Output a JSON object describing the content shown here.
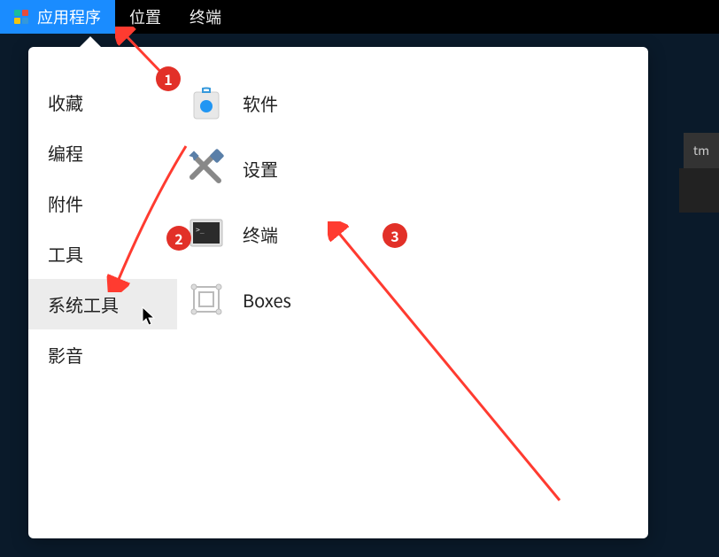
{
  "topbar": {
    "apps_label": "应用程序",
    "places_label": "位置",
    "terminal_label": "终端"
  },
  "sidebar": {
    "items": [
      {
        "label": "收藏"
      },
      {
        "label": "编程"
      },
      {
        "label": "附件"
      },
      {
        "label": "工具"
      },
      {
        "label": "系统工具"
      },
      {
        "label": "影音"
      }
    ]
  },
  "apps": {
    "items": [
      {
        "label": "软件",
        "icon": "software"
      },
      {
        "label": "设置",
        "icon": "settings"
      },
      {
        "label": "终端",
        "icon": "terminal"
      },
      {
        "label": "Boxes",
        "icon": "boxes"
      }
    ]
  },
  "annotations": {
    "badge1": "1",
    "badge2": "2",
    "badge3": "3"
  },
  "bg_text": "tm"
}
